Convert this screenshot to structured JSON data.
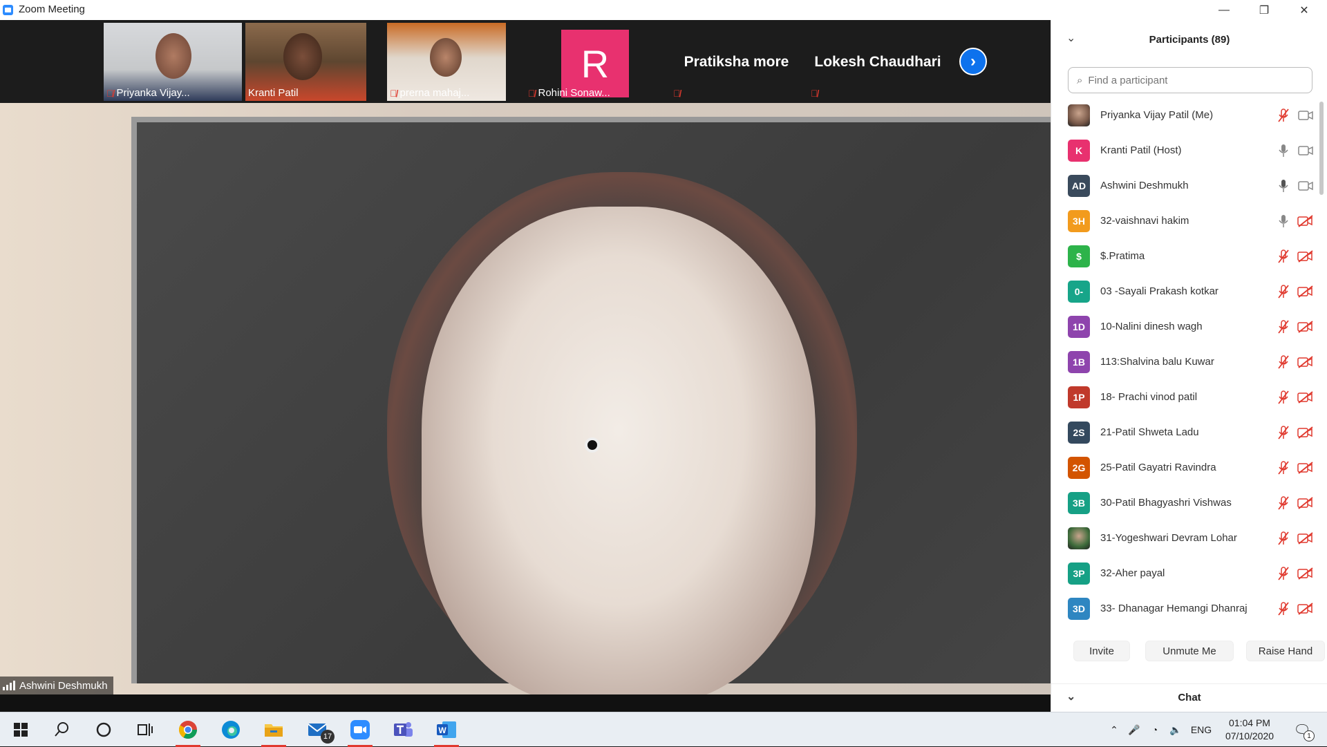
{
  "window": {
    "title": "Zoom Meeting",
    "controls": {
      "minimize": "—",
      "restore": "❐",
      "close": "✕"
    }
  },
  "gallery": {
    "tiles": [
      {
        "name": "Priyanka Vijay...",
        "muted": true
      },
      {
        "name": "Kranti Patil",
        "muted": false
      },
      {
        "name": "prerna mahaj...",
        "muted": true
      },
      {
        "name": "Rohini Sonaw...",
        "muted": true,
        "initial": "R",
        "initial_color": "#E8316F"
      },
      {
        "name": "Pratiksha more",
        "muted": true
      },
      {
        "name": "Lokesh Chaudhari",
        "muted": true
      }
    ],
    "next_icon": "chevron-right-icon"
  },
  "main_video": {
    "speaker": "Ashwini Deshmukh"
  },
  "participants": {
    "header": "Participants (89)",
    "search_placeholder": "Find a participant",
    "list": [
      {
        "name": "Priyanka Vijay Patil (Me)",
        "avatar": "photo",
        "color": "#7a5a4a",
        "mic": "muted",
        "video": "on"
      },
      {
        "name": "Kranti Patil (Host)",
        "avatar": "K",
        "color": "#E8316F",
        "mic": "on",
        "video": "on"
      },
      {
        "name": "Ashwini Deshmukh",
        "avatar": "AD",
        "color": "#3a4a5c",
        "mic": "active",
        "video": "on"
      },
      {
        "name": "32-vaishnavi hakim",
        "avatar": "3H",
        "color": "#F29B1D",
        "mic": "on",
        "video": "off"
      },
      {
        "name": "$.Pratima",
        "avatar": "$",
        "color": "#2DB34A",
        "mic": "muted",
        "video": "off"
      },
      {
        "name": "03 -Sayali  Prakash kotkar",
        "avatar": "0-",
        "color": "#17A589",
        "mic": "muted",
        "video": "off"
      },
      {
        "name": "10-Nalini dinesh wagh",
        "avatar": "1D",
        "color": "#8E44AD",
        "mic": "muted",
        "video": "off"
      },
      {
        "name": "113:Shalvina balu Kuwar",
        "avatar": "1B",
        "color": "#8E44AD",
        "mic": "muted",
        "video": "off"
      },
      {
        "name": "18- Prachi vinod patil",
        "avatar": "1P",
        "color": "#C0392B",
        "mic": "muted",
        "video": "off"
      },
      {
        "name": "21-Patil Shweta Ladu",
        "avatar": "2S",
        "color": "#34495E",
        "mic": "muted",
        "video": "off"
      },
      {
        "name": "25-Patil Gayatri Ravindra",
        "avatar": "2G",
        "color": "#D35400",
        "mic": "muted",
        "video": "off"
      },
      {
        "name": "30-Patil Bhagyashri Vishwas",
        "avatar": "3B",
        "color": "#16A085",
        "mic": "muted",
        "video": "off"
      },
      {
        "name": "31-Yogeshwari Devram Lohar",
        "avatar": "photo",
        "color": "#3d6b3a",
        "mic": "muted",
        "video": "off"
      },
      {
        "name": "32-Aher payal",
        "avatar": "3P",
        "color": "#16A085",
        "mic": "muted",
        "video": "off"
      },
      {
        "name": "33- Dhanagar Hemangi Dhanraj",
        "avatar": "3D",
        "color": "#2E86C1",
        "mic": "muted",
        "video": "off"
      }
    ],
    "buttons": {
      "invite": "Invite",
      "unmute": "Unmute Me",
      "raise_hand": "Raise Hand"
    },
    "chat_header": "Chat"
  },
  "taskbar": {
    "apps": [
      "start-icon",
      "search-icon",
      "cortana-icon",
      "task-view-icon",
      "chrome-icon",
      "edge-icon",
      "file-explorer-icon",
      "mail-icon",
      "zoom-icon",
      "teams-icon",
      "word-icon"
    ],
    "mail_badge": "17",
    "language": "ENG",
    "time": "01:04 PM",
    "date": "07/10/2020",
    "notification_count": "1"
  },
  "colors": {
    "accent": "#0E72ED",
    "muted_red": "#E0392E",
    "taskbar_active": "#E0392E"
  }
}
